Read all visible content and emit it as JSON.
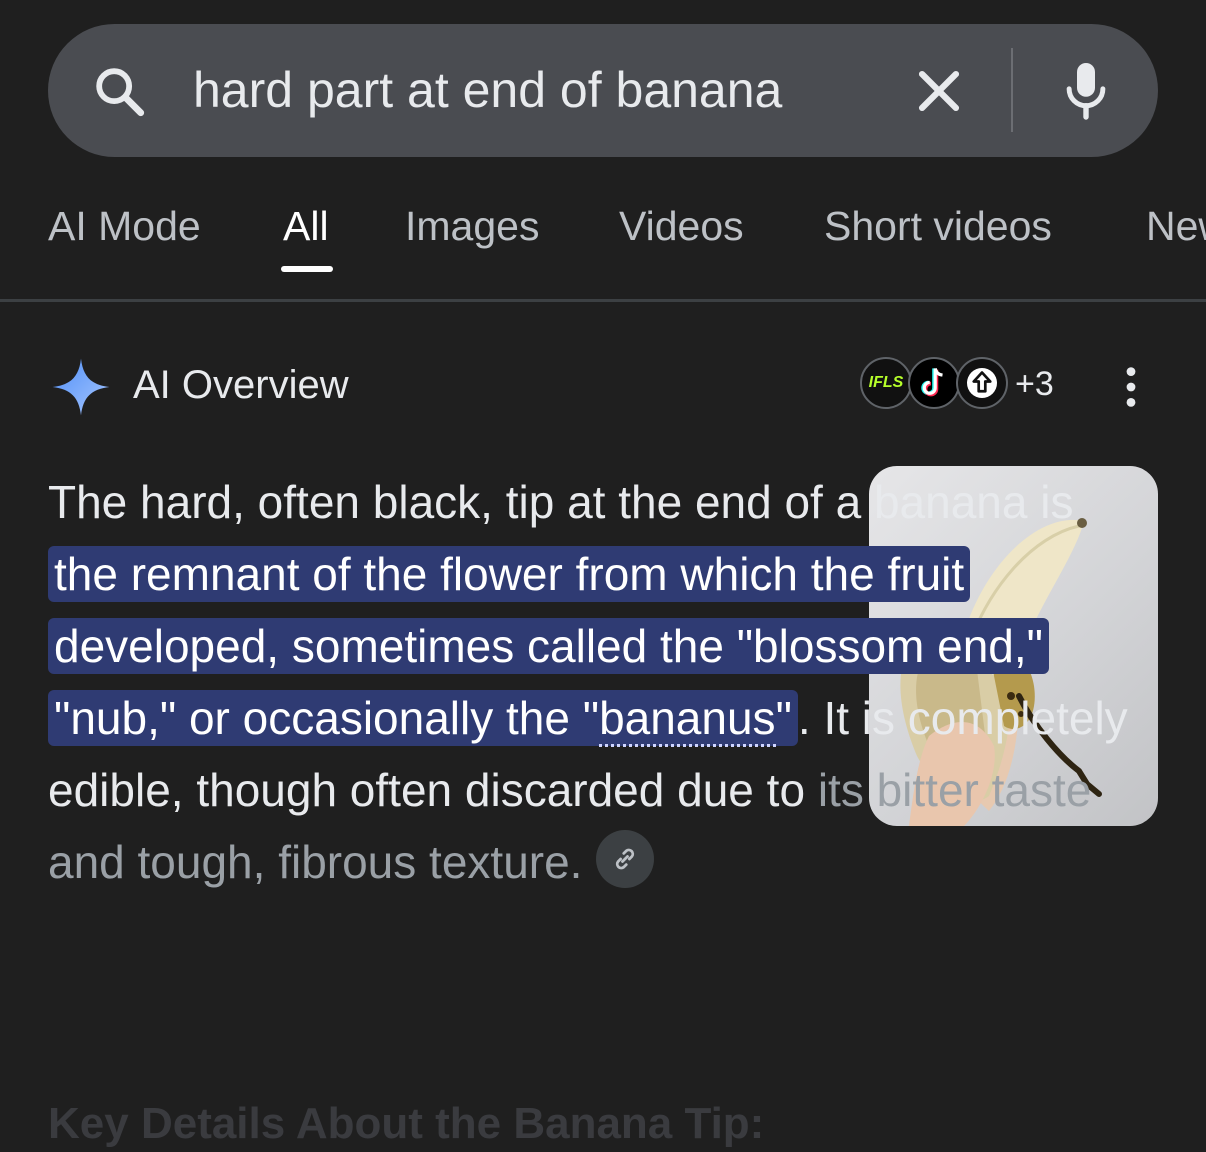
{
  "search": {
    "query": "hard part at end of banana",
    "search_icon": "search-icon",
    "clear_icon": "close-icon",
    "mic_icon": "microphone-icon"
  },
  "tabs": [
    {
      "label": "AI Mode",
      "active": false
    },
    {
      "label": "All",
      "active": true
    },
    {
      "label": "Images",
      "active": false
    },
    {
      "label": "Videos",
      "active": false
    },
    {
      "label": "Short videos",
      "active": false
    },
    {
      "label": "New",
      "active": false
    }
  ],
  "ai_overview": {
    "title": "AI Overview",
    "icon": "sparkle-icon",
    "sources": [
      {
        "label": "IFLS",
        "icon": "ifls-logo"
      },
      {
        "label": "",
        "icon": "tiktok-icon"
      },
      {
        "label": "",
        "icon": "upload-arrow-icon"
      }
    ],
    "more_sources": "+3",
    "menu_icon": "more-vert-icon",
    "answer": {
      "intro": "The hard, often black, tip at the end of a banana is ",
      "highlight": "the remnant of the flower from which the fruit developed, sometimes called the \"blossom end,\" \"nub,\" or occasionally the \"",
      "term": "bananus",
      "highlight_end": "\"",
      "rest": ". It is completely edible, though often discarded due to ",
      "faded": "its bitter taste and tough, fibrous texture."
    },
    "link_icon": "link-icon",
    "next_heading": "Key Details About the Banana Tip:"
  },
  "colors": {
    "background": "#1f1f1f",
    "search_bar": "#4a4c51",
    "highlight": "#2f3b73",
    "sparkle": "#8ab4f8"
  }
}
